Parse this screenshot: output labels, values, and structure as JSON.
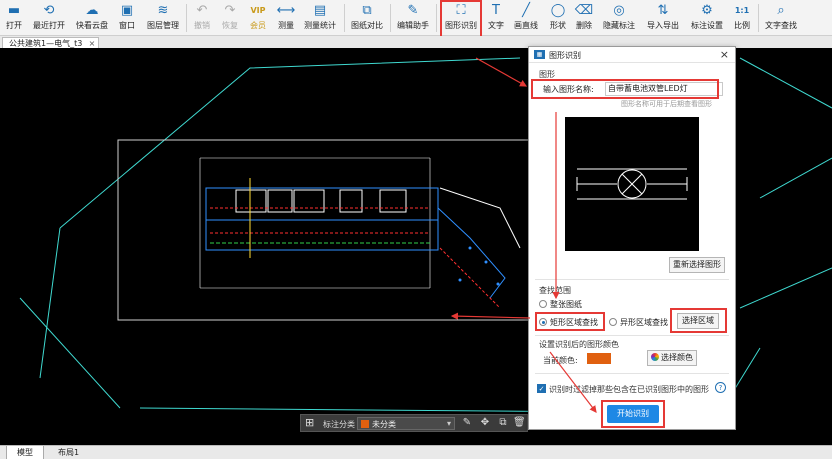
{
  "toolbar": {
    "items": [
      {
        "label": "打开",
        "icon": "folder-icon",
        "glyph": "▬"
      },
      {
        "label": "最近打开",
        "icon": "history-icon",
        "glyph": "⟲"
      },
      {
        "label": "快看云盘",
        "icon": "cloud-icon",
        "glyph": "☁"
      },
      {
        "label": "窗口",
        "icon": "window-icon",
        "glyph": "▣"
      },
      {
        "label": "图层管理",
        "icon": "layers-icon",
        "glyph": "≋"
      },
      {
        "label": "撤销",
        "icon": "undo-icon",
        "glyph": "↶"
      },
      {
        "label": "恢复",
        "icon": "redo-icon",
        "glyph": "↷"
      },
      {
        "label": "会员",
        "icon": "vip-icon",
        "glyph": "VIP"
      },
      {
        "label": "测量",
        "icon": "measure-icon",
        "glyph": "⟷"
      },
      {
        "label": "测量统计",
        "icon": "measure-stats-icon",
        "glyph": "▤"
      },
      {
        "label": "图纸对比",
        "icon": "compare-icon",
        "glyph": "⧉"
      },
      {
        "label": "编辑助手",
        "icon": "edit-assistant-icon",
        "glyph": "✎"
      },
      {
        "label": "图形识别",
        "icon": "shape-recognition-icon",
        "glyph": "⛶"
      },
      {
        "label": "文字",
        "icon": "text-icon",
        "glyph": "T"
      },
      {
        "label": "画直线",
        "icon": "line-icon",
        "glyph": "╱"
      },
      {
        "label": "形状",
        "icon": "shape-icon",
        "glyph": "◯"
      },
      {
        "label": "删除",
        "icon": "delete-icon",
        "glyph": "⌫"
      },
      {
        "label": "隐藏标注",
        "icon": "hide-annotation-icon",
        "glyph": "◎"
      },
      {
        "label": "导入导出",
        "icon": "import-export-icon",
        "glyph": "⇅"
      },
      {
        "label": "标注设置",
        "icon": "annotation-settings-icon",
        "glyph": "⚙"
      },
      {
        "label": "比例",
        "icon": "scale-icon",
        "glyph": "1:1"
      },
      {
        "label": "文字查找",
        "icon": "text-search-icon",
        "glyph": "⌕"
      }
    ]
  },
  "doc_tab": {
    "title": "公共建筑1—电气_t3",
    "close": "×"
  },
  "layout_tabs": [
    "模型",
    "布局1"
  ],
  "category_bar": {
    "label": "标注分类",
    "value": "未分类",
    "color": "#e06010"
  },
  "dialog": {
    "title": "图形识别",
    "close": "×",
    "section_shape": "图形",
    "name_label": "输入图形名称:",
    "name_value": "自带蓄电池双管LED灯",
    "name_hint": "图形名称可用于后期查看图形",
    "reselect_button": "重新选择图形",
    "section_scope": "查找范围",
    "scope_options": [
      "整张图纸",
      "矩形区域查找",
      "异形区域查找"
    ],
    "scope_selected": 1,
    "select_area_button": "选择区域",
    "section_color": "设置识别后的图形颜色",
    "current_color_label": "当前颜色:",
    "current_color": "#e06010",
    "choose_color_button": "选择颜色",
    "filter_label": "识别时过滤掉那些包含在已识别图形中的图形",
    "help": "?",
    "start_button": "开始识别"
  },
  "colors": {
    "accent": "#1e88e5",
    "highlight": "#e53935",
    "toolbar_icon": "#1f6fb2"
  }
}
